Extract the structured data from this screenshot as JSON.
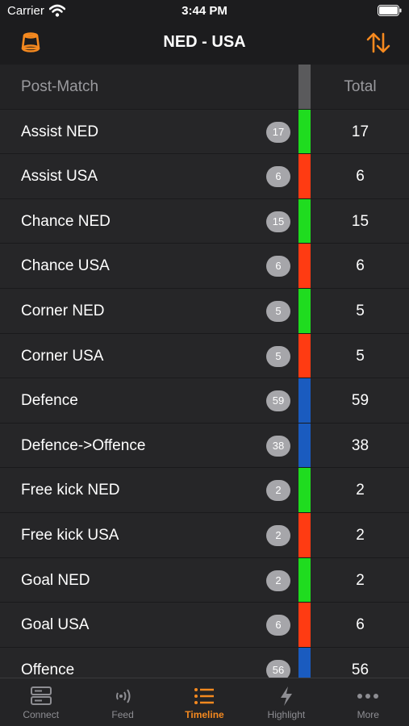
{
  "status_bar": {
    "carrier": "Carrier",
    "time": "3:44 PM"
  },
  "nav": {
    "title": "NED - USA"
  },
  "colors": {
    "accent": "#f5891f",
    "ned": "#1fdc1f",
    "usa": "#ff3b12",
    "neutral": "#1a5bbf",
    "header_strip": "#5a5a5c"
  },
  "table": {
    "header": {
      "label": "Post-Match",
      "total": "Total"
    },
    "rows": [
      {
        "label": "Assist NED",
        "count": "17",
        "total": "17",
        "team": "ned"
      },
      {
        "label": "Assist USA",
        "count": "6",
        "total": "6",
        "team": "usa"
      },
      {
        "label": "Chance NED",
        "count": "15",
        "total": "15",
        "team": "ned"
      },
      {
        "label": "Chance USA",
        "count": "6",
        "total": "6",
        "team": "usa"
      },
      {
        "label": "Corner NED",
        "count": "5",
        "total": "5",
        "team": "ned"
      },
      {
        "label": "Corner USA",
        "count": "5",
        "total": "5",
        "team": "usa"
      },
      {
        "label": "Defence",
        "count": "59",
        "total": "59",
        "team": "neutral"
      },
      {
        "label": "Defence->Offence",
        "count": "38",
        "total": "38",
        "team": "neutral"
      },
      {
        "label": "Free kick NED",
        "count": "2",
        "total": "2",
        "team": "ned"
      },
      {
        "label": "Free kick USA",
        "count": "2",
        "total": "2",
        "team": "usa"
      },
      {
        "label": "Goal NED",
        "count": "2",
        "total": "2",
        "team": "ned"
      },
      {
        "label": "Goal USA",
        "count": "6",
        "total": "6",
        "team": "usa"
      },
      {
        "label": "Offence",
        "count": "56",
        "total": "56",
        "team": "neutral"
      }
    ]
  },
  "tabs": [
    {
      "label": "Connect",
      "icon": "server-icon"
    },
    {
      "label": "Feed",
      "icon": "broadcast-icon"
    },
    {
      "label": "Timeline",
      "icon": "list-icon",
      "active": true
    },
    {
      "label": "Highlight",
      "icon": "bolt-icon"
    },
    {
      "label": "More",
      "icon": "ellipsis-icon"
    }
  ]
}
